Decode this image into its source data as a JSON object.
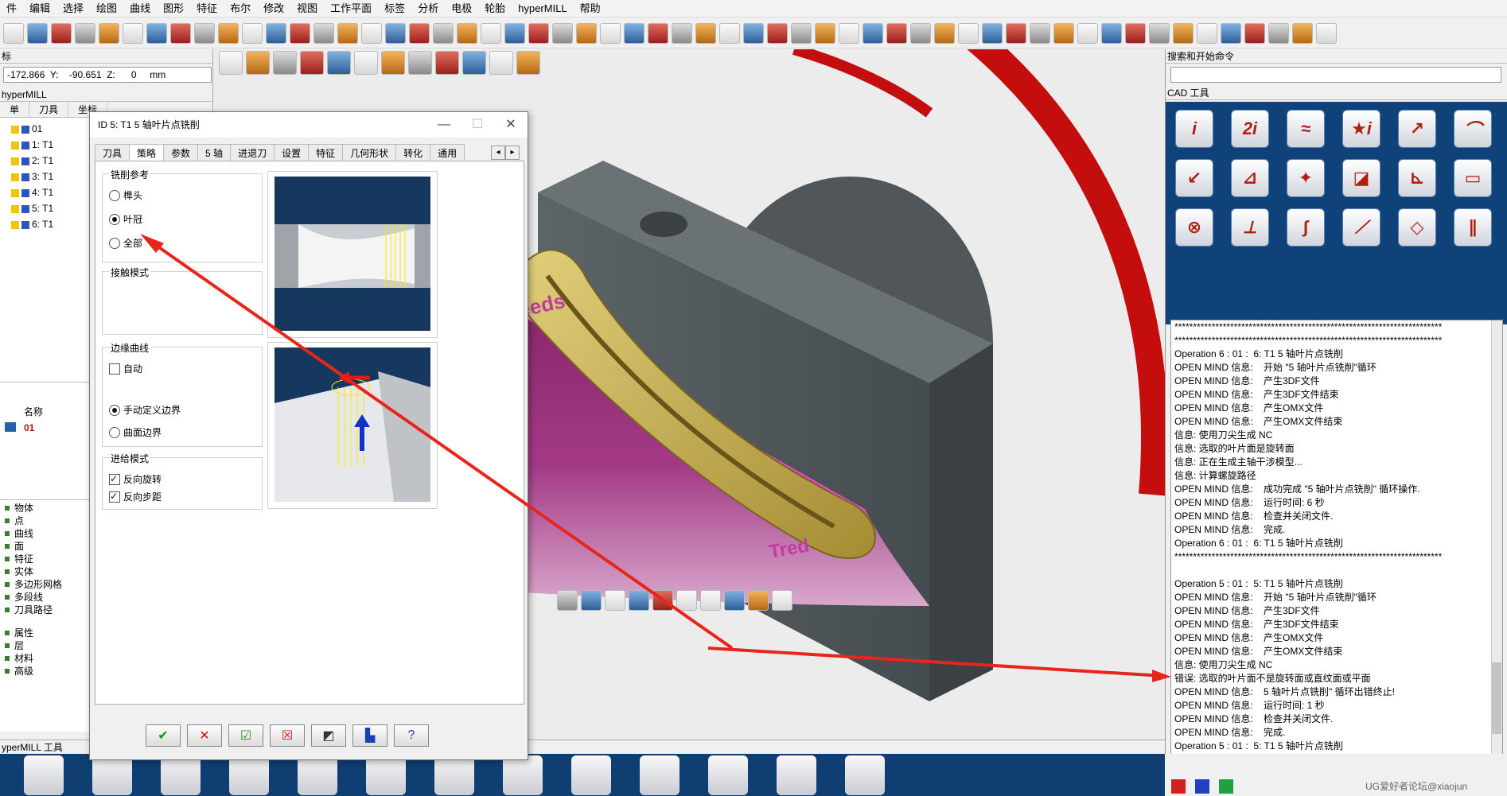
{
  "menu": [
    "件",
    "编辑",
    "选择",
    "绘图",
    "曲线",
    "图形",
    "特征",
    "布尔",
    "修改",
    "视图",
    "工作平面",
    "标签",
    "分析",
    "电极",
    "轮胎",
    "hyperMILL",
    "帮助"
  ],
  "coord": {
    "text": "-172.866  Y:    -90.651  Z:      0     mm",
    "header": "标"
  },
  "left_panel": {
    "title": "hyperMILL",
    "tabs": [
      "单",
      "刀具",
      "坐标"
    ],
    "jobs": [
      "01",
      "1: T1",
      "2: T1",
      "3: T1",
      "4: T1",
      "5: T1",
      "6: T1"
    ],
    "name_header": "名称",
    "name_value": "01"
  },
  "tree": {
    "items": [
      "物体",
      "点",
      "曲线",
      "面",
      "特征",
      "实体",
      "多边形网格",
      "多段线",
      "刀具路径"
    ],
    "items2": [
      "属性",
      "层",
      "材料",
      "高级"
    ]
  },
  "bottom_tools_title": "yperMILL 工具",
  "dialog": {
    "title": "ID 5: T1 5 轴叶片点铣削",
    "tabs": [
      "刀具",
      "策略",
      "参数",
      "5 轴",
      "进退刀",
      "设置",
      "特征",
      "几何形状",
      "转化",
      "通用"
    ],
    "active_tab": "策略",
    "group_mill_ref": "铣削参考",
    "radio_hub": "榫头",
    "radio_shroud": "叶冠",
    "radio_all": "全部",
    "group_contact": "接触模式",
    "group_edge": "边缘曲线",
    "check_auto": "自动",
    "radio_manual": "手动定义边界",
    "radio_surface": "曲面边界",
    "group_feed": "进给模式",
    "check_reverse_rot": "反向旋转",
    "check_reverse_step": "反向步距"
  },
  "right_panel": {
    "search_title": "搜索和开始命令",
    "cad_title": "CAD 工具",
    "cad_icons": [
      "i",
      "2i",
      "≈",
      "★i",
      "↗",
      "⌒",
      "↙",
      "⊿",
      "✦",
      "◪",
      "⊾",
      "▭",
      "⊗",
      "⟂",
      "∫",
      "⟋",
      "◇",
      "∥"
    ],
    "log_lines": [
      "************************************************************************",
      "************************************************************************",
      "Operation 6 : 01 :  6: T1 5 轴叶片点铣削",
      "OPEN MIND 信息:    开始 \"5 轴叶片点铣削\"循环",
      "OPEN MIND 信息:    产生3DF文件",
      "OPEN MIND 信息:    产生3DF文件结束",
      "OPEN MIND 信息:    产生OMX文件",
      "OPEN MIND 信息:    产生OMX文件结束",
      "信息: 使用刀尖生成 NC",
      "信息: 选取的叶片面是旋转面",
      "信息: 正在生成主轴干涉模型...",
      "信息: 计算螺旋路径",
      "OPEN MIND 信息:    成功完成 \"5 轴叶片点铣削\" 循环操作.",
      "OPEN MIND 信息:    运行时间: 6 秒",
      "OPEN MIND 信息:    检查并关闭文件.",
      "OPEN MIND 信息:    完成.",
      "Operation 6 : 01 :  6: T1 5 轴叶片点铣削",
      "************************************************************************",
      "",
      "Operation 5 : 01 :  5: T1 5 轴叶片点铣削",
      "OPEN MIND 信息:    开始 \"5 轴叶片点铣削\"循环",
      "OPEN MIND 信息:    产生3DF文件",
      "OPEN MIND 信息:    产生3DF文件结束",
      "OPEN MIND 信息:    产生OMX文件",
      "OPEN MIND 信息:    产生OMX文件结束",
      "信息: 使用刀尖生成 NC",
      "错误: 选取的叶片面不是旋转面或直纹面或平面",
      "OPEN MIND 信息:    5 轴叶片点铣削\" 循环出错终止!",
      "OPEN MIND 信息:    运行时间: 1 秒",
      "OPEN MIND 信息:    检查并关闭文件.",
      "OPEN MIND 信息:    完成.",
      "Operation 5 : 01 :  5: T1 5 轴叶片点铣削",
      "************************************************************************"
    ]
  },
  "viewport_labels": {
    "lead": "peeds",
    "tip": "Tred"
  },
  "watermark": "UG爱好者论坛@xiaojun",
  "colors": {
    "accent_red": "#e8251a",
    "blade_magenta": "#a02a78",
    "bottom_blue": "#0f3e73"
  }
}
